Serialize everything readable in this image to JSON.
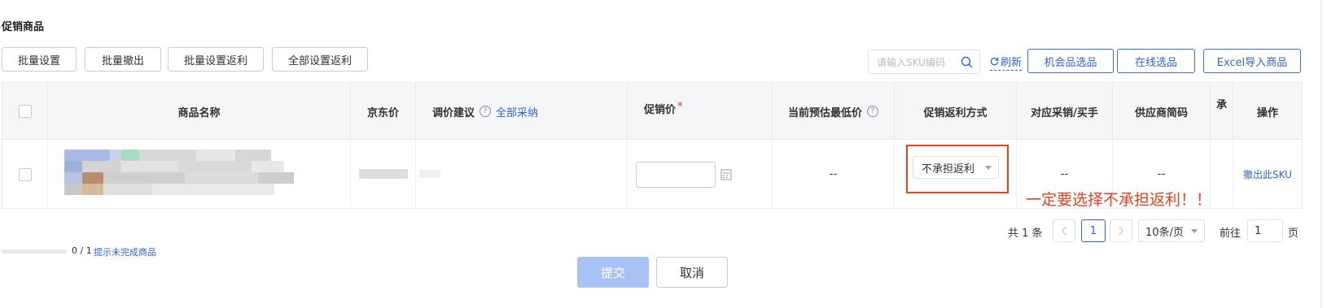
{
  "section_title": "促销商品",
  "toolbar": {
    "batch_set": "批量设置",
    "batch_withdraw": "批量撤出",
    "batch_set_rebate": "批量设置返利",
    "all_set_rebate": "全部设置返利",
    "search_placeholder": "请输入SKU编码",
    "refresh": "刷新",
    "opportunity_select": "机会品选品",
    "online_select": "在线选品",
    "excel_import": "Excel导入商品"
  },
  "table": {
    "headers": {
      "product_name": "商品名称",
      "jd_price": "京东价",
      "price_suggestion": "调价建议",
      "accept_all": "全部采纳",
      "promo_price": "促销价",
      "required_mark": "*",
      "estimated_lowest": "当前预估最低价",
      "rebate_method": "促销返利方式",
      "purchase_sales": "对应采销/买手",
      "supplier_code": "供应商简码",
      "bear": "承",
      "actions": "操作"
    },
    "row": {
      "estimated_lowest": "--",
      "rebate_method": "不承担返利",
      "purchase_sales": "--",
      "supplier_code": "--",
      "action_withdraw": "撤出此SKU"
    }
  },
  "annotation_note": "一定要选择不承担返利！！",
  "pagination": {
    "total": "共 1 条",
    "current_page": "1",
    "page_size": "10条/页",
    "goto_label": "前往",
    "goto_value": "1",
    "page_unit": "页"
  },
  "progress": {
    "text": "0 / 1",
    "value": 0,
    "hint_link": "提示未完成商品"
  },
  "footer": {
    "submit": "提交",
    "cancel": "取消"
  },
  "colors": {
    "accent": "#2f63e6",
    "annotation": "#e8411e",
    "submit_disabled": "#a9c2f5"
  }
}
